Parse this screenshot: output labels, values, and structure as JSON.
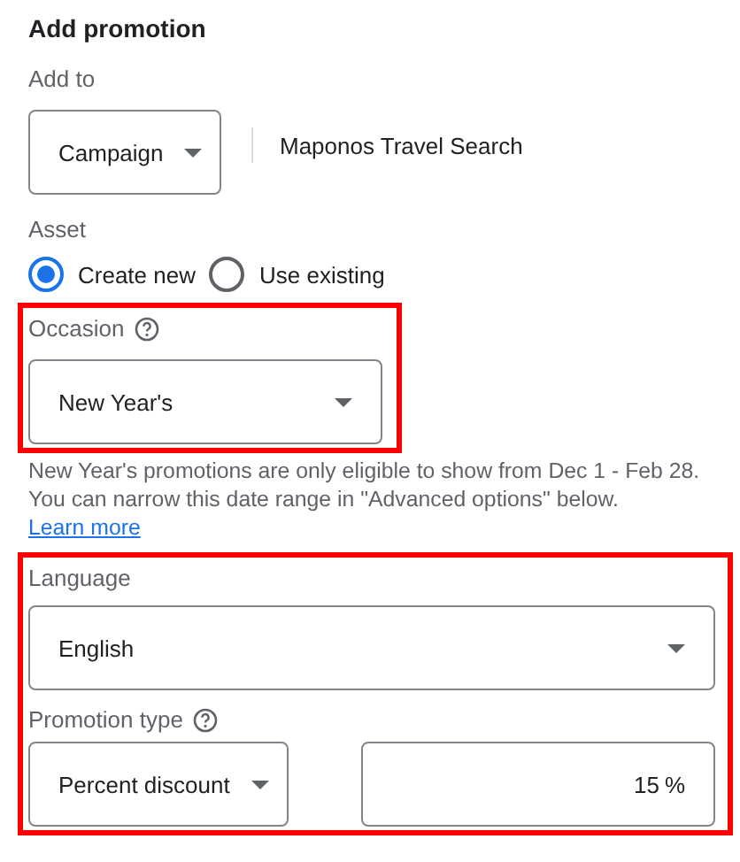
{
  "title": "Add promotion",
  "add_to": {
    "label": "Add to",
    "dropdown": {
      "value": "Campaign"
    },
    "campaign_name": "Maponos Travel Search"
  },
  "asset": {
    "label": "Asset",
    "options": [
      {
        "label": "Create new",
        "selected": true
      },
      {
        "label": "Use existing",
        "selected": false
      }
    ]
  },
  "occasion": {
    "highlighted": true,
    "label": "Occasion",
    "help_icon": true,
    "dropdown": {
      "value": "New Year's"
    }
  },
  "occasion_note": {
    "text": "New Year's promotions are only eligible to show from Dec 1 - Feb 28. You can narrow this date range in \"Advanced options\" below.",
    "link": "Learn more"
  },
  "details": {
    "highlighted": true,
    "language": {
      "label": "Language",
      "dropdown": {
        "value": "English"
      }
    },
    "promotion_type": {
      "label": "Promotion type",
      "help_icon": true,
      "dropdown": {
        "value": "Percent discount"
      },
      "amount": {
        "value": "15",
        "suffix": "%"
      }
    }
  }
}
